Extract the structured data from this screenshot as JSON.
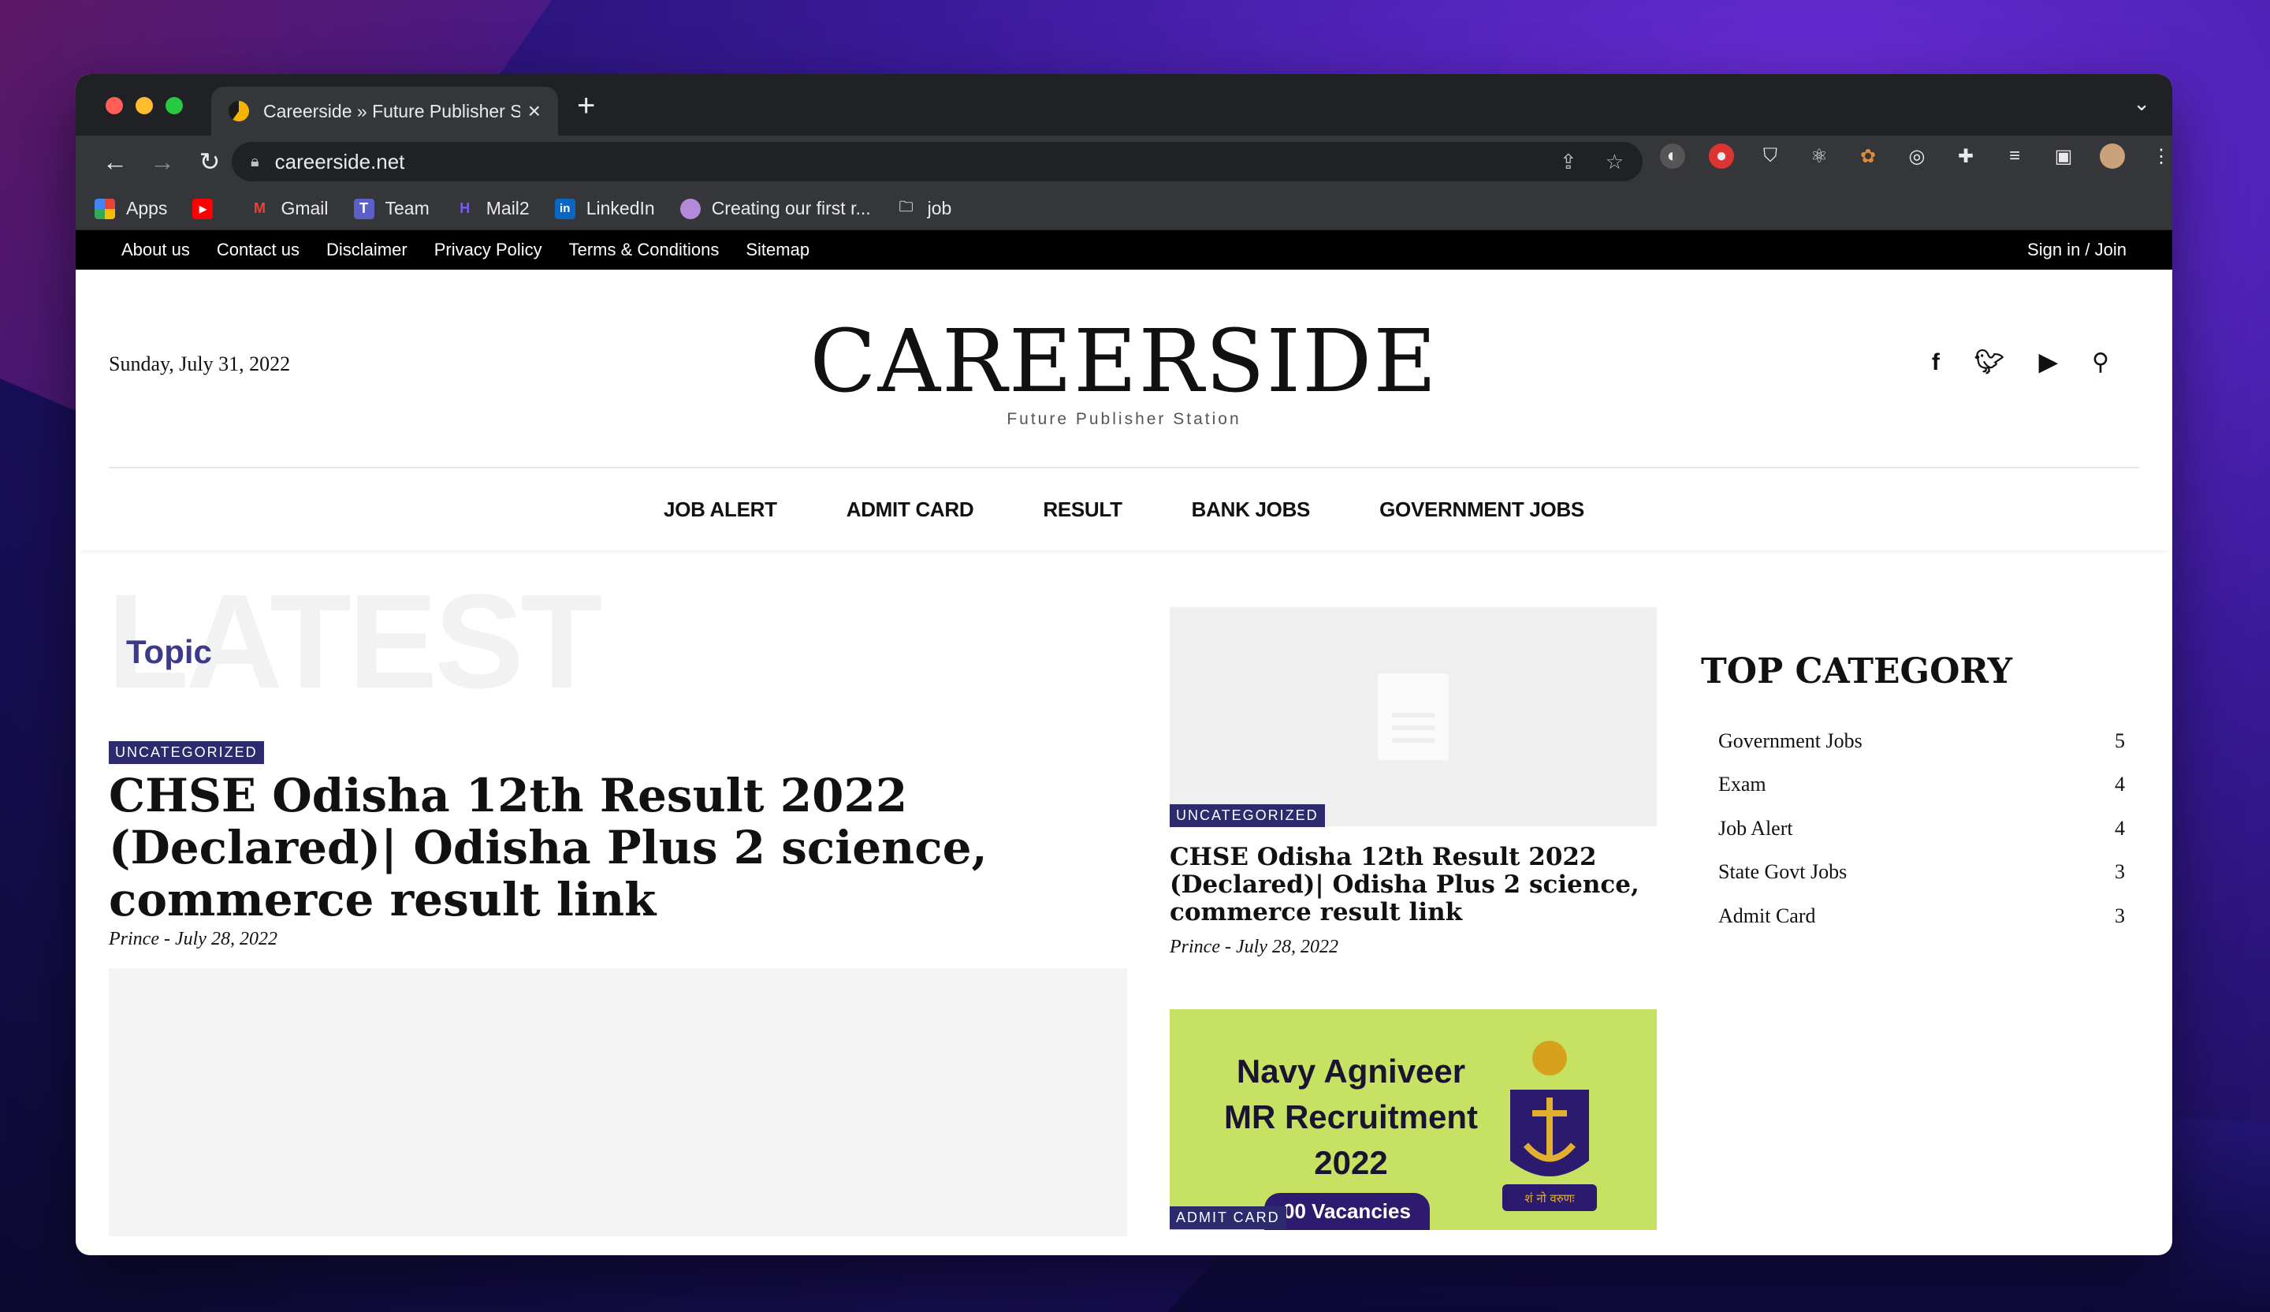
{
  "browser": {
    "tab_title": "Careerside » Future Publisher S",
    "url": "careerside.net",
    "bookmarks": [
      {
        "label": "Apps",
        "icon": "apps-grid-icon"
      },
      {
        "label": "",
        "icon": "youtube-icon"
      },
      {
        "label": "Gmail",
        "icon": "gmail-icon"
      },
      {
        "label": "Team",
        "icon": "teams-icon"
      },
      {
        "label": "Mail2",
        "icon": "mail2-icon"
      },
      {
        "label": "LinkedIn",
        "icon": "linkedin-icon"
      },
      {
        "label": "Creating our first r...",
        "icon": "avatar-icon"
      },
      {
        "label": "job",
        "icon": "folder-icon"
      }
    ]
  },
  "site": {
    "topbar": {
      "links": [
        "About us",
        "Contact us",
        "Disclaimer",
        "Privacy Policy",
        "Terms & Conditions",
        "Sitemap"
      ],
      "signin": "Sign in / Join"
    },
    "date": "Sunday, July 31, 2022",
    "logo": "CAREERSIDE",
    "tagline": "Future Publisher Station",
    "nav": [
      "JOB ALERT",
      "ADMIT CARD",
      "RESULT",
      "BANK JOBS",
      "GOVERNMENT JOBS"
    ]
  },
  "main": {
    "bg_word": "LATEST",
    "topic_label": "Topic",
    "lead": {
      "category": "UNCATEGORIZED",
      "title": "CHSE Odisha 12th Result 2022 (Declared)| Odisha Plus 2 science, commerce result link",
      "author": "Prince",
      "date": "July 28, 2022"
    },
    "card1": {
      "category": "UNCATEGORIZED",
      "title": "CHSE Odisha 12th Result 2022 (Declared)| Odisha Plus 2 science, commerce result link",
      "author": "Prince",
      "date": "July 28, 2022"
    },
    "card2": {
      "category": "ADMIT CARD",
      "image_text_line1": "Navy Agniveer",
      "image_text_line2": "MR Recruitment",
      "image_text_line3": "2022",
      "image_banner": "00 Vacancies",
      "emblem_text": "शं नो वरुणः"
    }
  },
  "sidebar": {
    "title": "TOP CATEGORY",
    "categories": [
      {
        "name": "Government Jobs",
        "count": "5"
      },
      {
        "name": "Exam",
        "count": "4"
      },
      {
        "name": "Job Alert",
        "count": "4"
      },
      {
        "name": "State Govt Jobs",
        "count": "3"
      },
      {
        "name": "Admit Card",
        "count": "3"
      }
    ]
  },
  "colors": {
    "badge_bg": "#2e2a6e",
    "topic": "#3b3b8a",
    "navy_card_bg": "#c7e263"
  }
}
